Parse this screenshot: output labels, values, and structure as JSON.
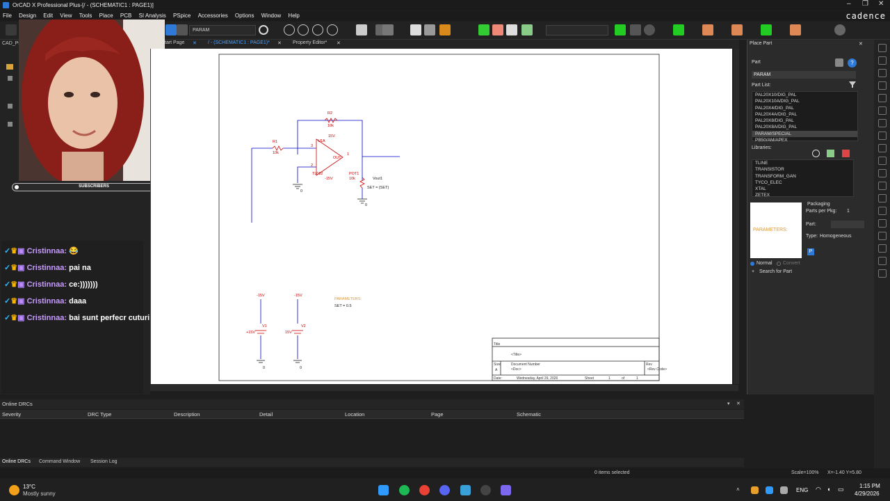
{
  "window": {
    "title": "OrCAD X Professional Plus-[/ - (SCHEMATIC1 : PAGE1)]",
    "brand": "cadence"
  },
  "menu": [
    "File",
    "Design",
    "Edit",
    "View",
    "Tools",
    "Place",
    "PCB",
    "SI Analysis",
    "PSpice",
    "Accessories",
    "Options",
    "Window",
    "Help"
  ],
  "toolbar": {
    "part_combo": "PARAM"
  },
  "tabs": [
    "tart Page",
    "/ - (SCHEMATIC1 : PAGE1)*",
    "Property Editor*"
  ],
  "left": {
    "project_label": "CAD_Pr",
    "subscribers": "SUBSCRIBERS"
  },
  "chat": {
    "messages": [
      {
        "user": "Cristinnaa:",
        "text": "😂"
      },
      {
        "user": "Cristinnaa:",
        "text": "pai na"
      },
      {
        "user": "Cristinnaa:",
        "text": "ce:)))))))"
      },
      {
        "user": "Cristinnaa:",
        "text": "daaa"
      },
      {
        "user": "Cristinnaa:",
        "text": "bai sunt perfecr cuturi"
      }
    ]
  },
  "schematic": {
    "r2": {
      "name": "R2",
      "value": "10k"
    },
    "r1": {
      "name": "R1",
      "value": "10k"
    },
    "opamp": {
      "name": "U1A",
      "model": "TL082",
      "pin_plus": "3",
      "pin_minus": "2",
      "pin_out": "1",
      "pos_rail": "15V",
      "neg_rail": "-15V",
      "out_label": "OUT"
    },
    "pot": {
      "name": "POT1",
      "value": "10k",
      "set": "SET = {SET}"
    },
    "vout": "Vout1",
    "gnd": "0",
    "v1": {
      "name": "V1",
      "value": "+15V",
      "top": "-15V"
    },
    "v2": {
      "name": "V2",
      "value": "15V",
      "top": "-15V"
    },
    "params": {
      "title": "PARAMETERS:",
      "set": "SET = 0.5"
    },
    "titleblock": {
      "title_label": "Title",
      "title": "<Title>",
      "size_label": "Size",
      "size": "A",
      "doc_label": "Document Number",
      "doc": "<Doc>",
      "rev_label": "Rev",
      "rev": "<Rev Code>",
      "date_label": "Date:",
      "date": "Wednesday, April 29, 2026",
      "sheet_label": "Sheet",
      "sheet": "1",
      "of_label": "of",
      "of": "1"
    }
  },
  "place_part": {
    "title": "Place Part",
    "part_label": "Part",
    "part_value": "PARAM",
    "part_list_label": "Part List:",
    "parts": [
      "PAL20X10/DIG_PAL",
      "PAL20X10A/DIG_PAL",
      "PAL20X4/DIG_PAL",
      "PAL20X4A/DIG_PAL",
      "PAL20X8/DIG_PAL",
      "PAL20X8A/DIG_PAL",
      "PARAM/SPECIAL",
      "PB50/AM/APEX"
    ],
    "selected_part": "PARAM/SPECIAL",
    "libraries_label": "Libraries:",
    "libraries": [
      "TLINE",
      "TRANSISTOR",
      "TRANSFORM_GAN",
      "TYCO_ELEC",
      "XTAL",
      "ZETEX"
    ],
    "preview_text": "PARAMETERS:",
    "packaging_label": "Packaging",
    "parts_per_pkg_label": "Parts per Pkg:",
    "parts_per_pkg": "1",
    "part_field_label": "Part:",
    "type_label": "Type:",
    "type_value": "Homogeneous",
    "normal_label": "Normal",
    "convert_label": "Convert",
    "search_label": "Search for Part"
  },
  "bottom": {
    "title": "Online DRCs",
    "columns": [
      "Severity",
      "DRC Type",
      "Description",
      "Detail",
      "Location",
      "Page",
      "Schematic"
    ],
    "tabs": [
      "Online DRCs",
      "Command Window",
      "Session Log"
    ]
  },
  "status": {
    "selection": "0 items selected",
    "scale": "Scale=100%",
    "coords": "X=-1.40  Y=5.80"
  },
  "taskbar": {
    "weather_temp": "13°C",
    "weather_desc": "Mostly sunny",
    "lang": "ENG",
    "time": "1:15 PM",
    "date": "4/29/2026"
  }
}
